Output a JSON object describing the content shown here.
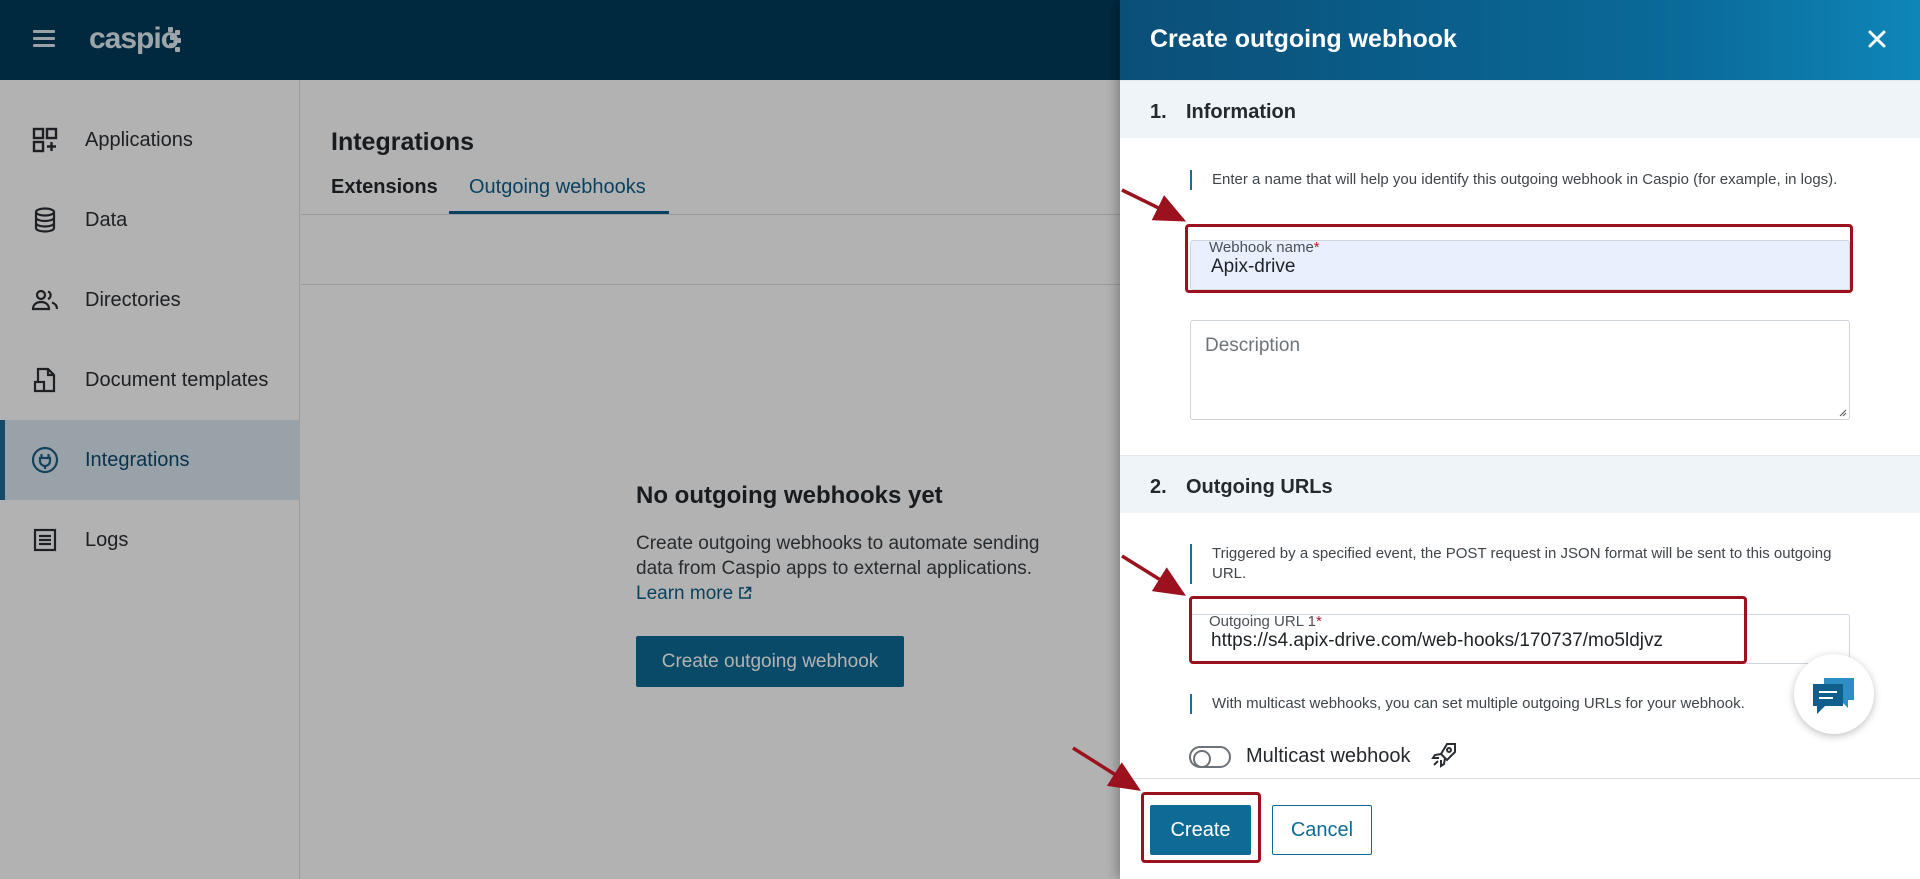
{
  "app": {
    "logo_text": "caspio"
  },
  "sidebar": {
    "items": [
      {
        "label": "Applications",
        "icon": "apps-icon"
      },
      {
        "label": "Data",
        "icon": "database-icon"
      },
      {
        "label": "Directories",
        "icon": "users-icon"
      },
      {
        "label": "Document templates",
        "icon": "document-icon"
      },
      {
        "label": "Integrations",
        "icon": "plug-icon",
        "active": true
      },
      {
        "label": "Logs",
        "icon": "list-icon"
      }
    ]
  },
  "main": {
    "title": "Integrations",
    "tabs": [
      {
        "label": "Extensions"
      },
      {
        "label": "Outgoing webhooks",
        "active": true
      }
    ],
    "empty_state": {
      "title": "No outgoing webhooks yet",
      "text": "Create outgoing webhooks to automate sending data from Caspio apps to external applications.",
      "link": "Learn more",
      "button": "Create outgoing webhook"
    }
  },
  "drawer": {
    "title": "Create outgoing webhook",
    "sections": [
      {
        "num": "1.",
        "title": "Information",
        "hint": "Enter a name that will help you identify this outgoing webhook in Caspio (for example, in logs).",
        "name_label": "Webhook name",
        "name_value": "Apix-drive",
        "description_placeholder": "Description"
      },
      {
        "num": "2.",
        "title": "Outgoing URLs",
        "hint": "Triggered by a specified event, the POST request in JSON format will be sent to this outgoing URL.",
        "url_label": "Outgoing URL 1",
        "url_value": "https://s4.apix-drive.com/web-hooks/170737/mo5ldjvz",
        "multicast_hint": "With multicast webhooks, you can set multiple outgoing URLs for your webhook.",
        "multicast_label": "Multicast webhook"
      }
    ],
    "required_mark": "*",
    "buttons": {
      "create": "Create",
      "cancel": "Cancel"
    }
  },
  "colors": {
    "header_bg": "#003b5c",
    "accent": "#0e6b96",
    "annotation_red": "#9b111e"
  }
}
